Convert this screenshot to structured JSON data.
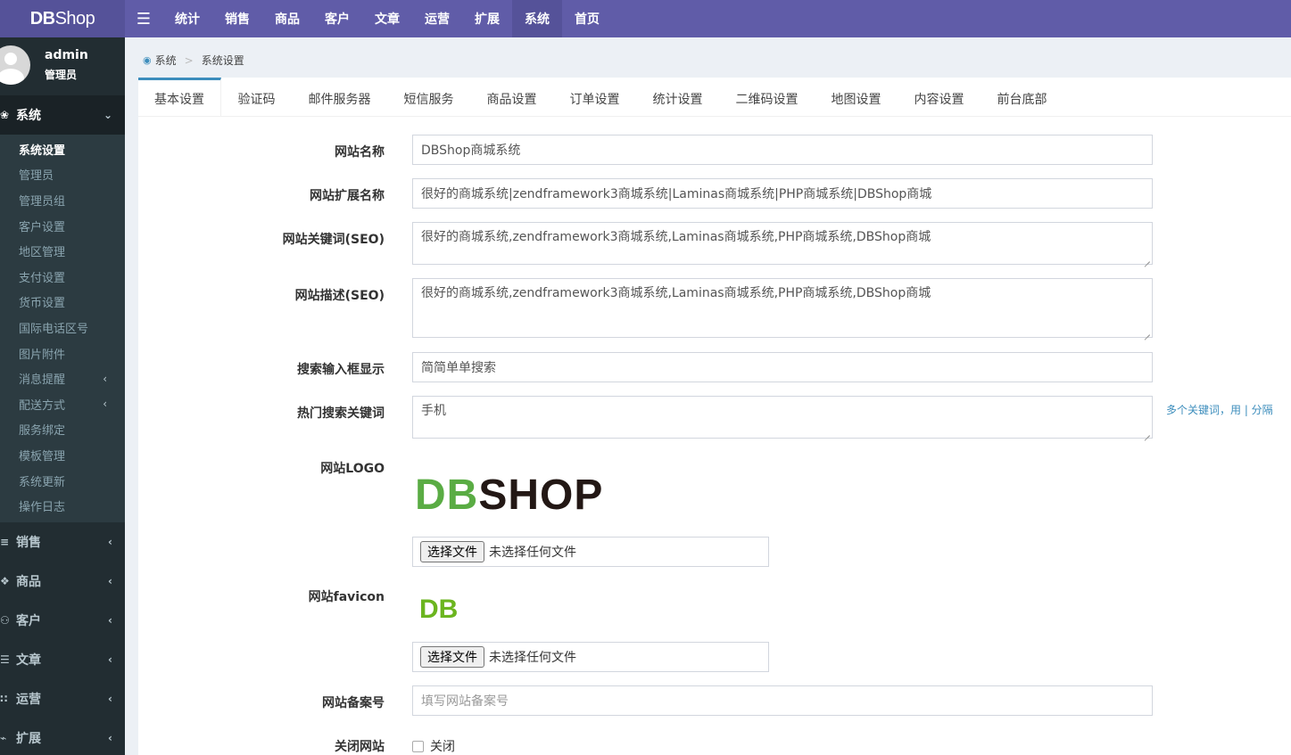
{
  "brand": {
    "logo_bold": "DB",
    "logo_light": "Shop"
  },
  "topnav": {
    "items": [
      "统计",
      "销售",
      "商品",
      "客户",
      "文章",
      "运营",
      "扩展",
      "系统",
      "首页"
    ],
    "active_index": 7
  },
  "user": {
    "name": "admin",
    "role": "管理员"
  },
  "sidebar": {
    "open_section": {
      "label": "系统",
      "icon": "gears-icon"
    },
    "sub_items": [
      {
        "label": "系统设置",
        "active": true,
        "chevron": false
      },
      {
        "label": "管理员",
        "chevron": false
      },
      {
        "label": "管理员组",
        "chevron": false
      },
      {
        "label": "客户设置",
        "chevron": false
      },
      {
        "label": "地区管理",
        "chevron": false
      },
      {
        "label": "支付设置",
        "chevron": false
      },
      {
        "label": "货币设置",
        "chevron": false
      },
      {
        "label": "国际电话区号",
        "chevron": false
      },
      {
        "label": "图片附件",
        "chevron": false
      },
      {
        "label": "消息提醒",
        "chevron": true
      },
      {
        "label": "配送方式",
        "chevron": true
      },
      {
        "label": "服务绑定",
        "chevron": false
      },
      {
        "label": "模板管理",
        "chevron": false
      },
      {
        "label": "系统更新",
        "chevron": false
      },
      {
        "label": "操作日志",
        "chevron": false
      }
    ],
    "sections": [
      {
        "label": "销售",
        "icon": "database-icon"
      },
      {
        "label": "商品",
        "icon": "cubes-icon"
      },
      {
        "label": "客户",
        "icon": "users-icon"
      },
      {
        "label": "文章",
        "icon": "book-icon"
      },
      {
        "label": "运营",
        "icon": "sitemap-icon"
      },
      {
        "label": "扩展",
        "icon": "plug-icon"
      }
    ]
  },
  "breadcrumb": {
    "root": "系统",
    "current": "系统设置"
  },
  "tabs": [
    "基本设置",
    "验证码",
    "邮件服务器",
    "短信服务",
    "商品设置",
    "订单设置",
    "统计设置",
    "二维码设置",
    "地图设置",
    "内容设置",
    "前台底部"
  ],
  "active_tab": 0,
  "form": {
    "site_name": {
      "label": "网站名称",
      "value": "DBShop商城系统"
    },
    "site_ext_name": {
      "label": "网站扩展名称",
      "value": "很好的商城系统|zendframework3商城系统|Laminas商城系统|PHP商城系统|DBShop商城"
    },
    "site_keywords": {
      "label": "网站关键词(SEO)",
      "value": "很好的商城系统,zendframework3商城系统,Laminas商城系统,PHP商城系统,DBShop商城"
    },
    "site_description": {
      "label": "网站描述(SEO)",
      "value": "很好的商城系统,zendframework3商城系统,Laminas商城系统,PHP商城系统,DBShop商城"
    },
    "search_box_display": {
      "label": "搜索输入框显示",
      "value": "简简单单搜索"
    },
    "hot_keywords": {
      "label": "热门搜索关键词",
      "value": "手机",
      "help": "多个关键词，用 | 分隔"
    },
    "site_logo": {
      "label": "网站LOGO",
      "image_text_green": "DB",
      "image_text_dark": "SHOP",
      "file_button": "选择文件",
      "file_status": "未选择任何文件"
    },
    "site_favicon": {
      "label": "网站favicon",
      "image_text": "DB",
      "file_button": "选择文件",
      "file_status": "未选择任何文件"
    },
    "icp_number": {
      "label": "网站备案号",
      "placeholder": "填写网站备案号"
    },
    "close_site": {
      "label": "关闭网站",
      "option": "关闭",
      "checked": false
    }
  },
  "colors": {
    "header": "#605ca8",
    "sidebar": "#222d32",
    "accent": "#3c8dbc"
  }
}
